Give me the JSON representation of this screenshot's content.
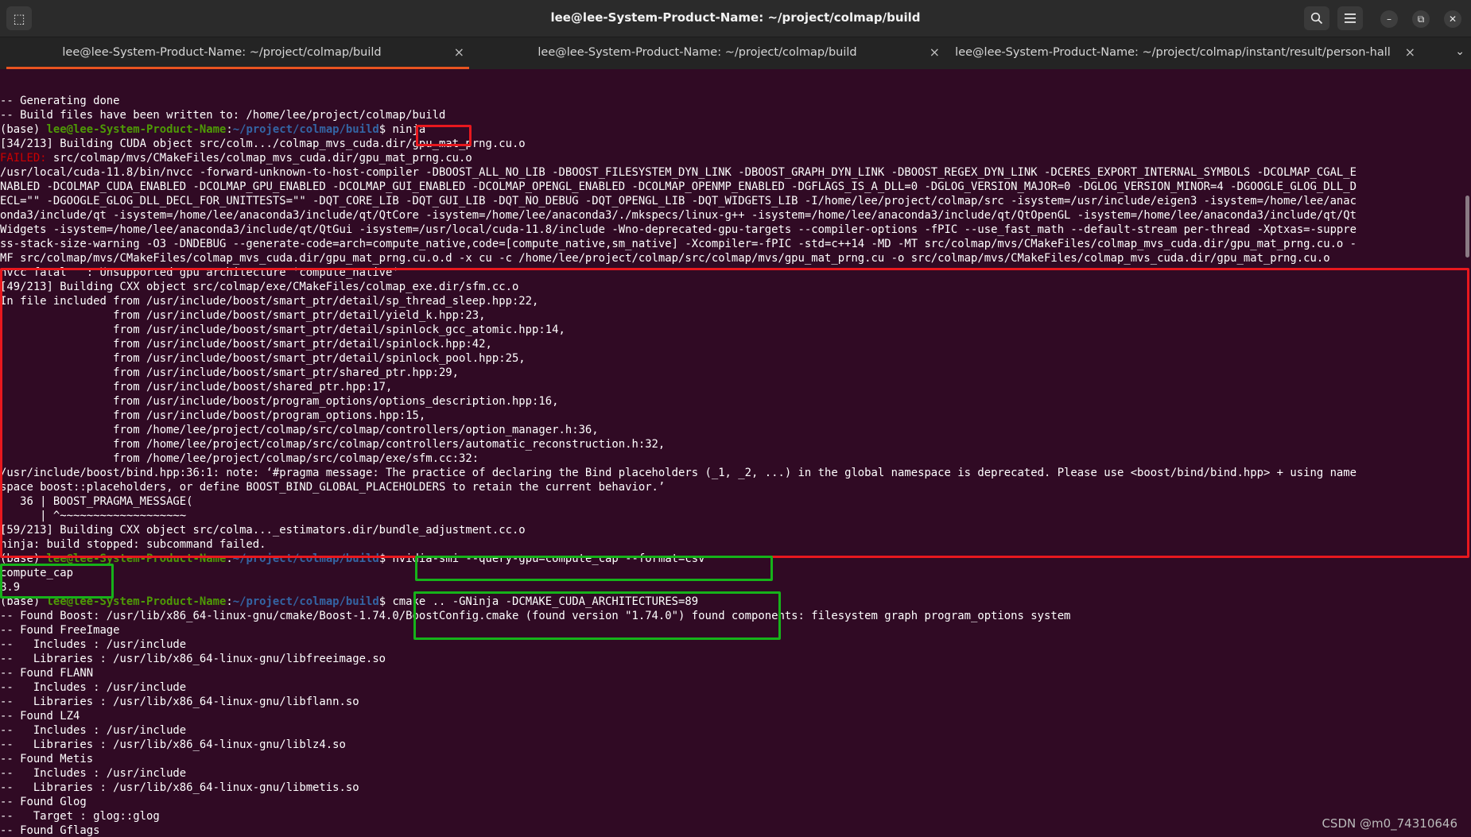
{
  "window": {
    "title": "lee@lee-System-Product-Name: ~/project/colmap/build",
    "new_tab_icon": "⬚",
    "search_icon": "⌕",
    "menu_icon": "☰",
    "minimize_icon": "–",
    "maximize_icon": "⧉",
    "close_icon": "✕"
  },
  "tabs": [
    {
      "label": "lee@lee-System-Product-Name: ~/project/colmap/build",
      "close": "×"
    },
    {
      "label": "lee@lee-System-Product-Name: ~/project/colmap/build",
      "close": "×"
    },
    {
      "label": "lee@lee-System-Product-Name: ~/project/colmap/instant/result/person-hall",
      "close": "×"
    }
  ],
  "tab_menu_icon": "⌄",
  "colors": {
    "background": "#300a24",
    "prompt_user": "#4e9a06",
    "prompt_path": "#3465a4",
    "failed": "#cc0000",
    "annotation_red": "#e8181e",
    "annotation_green": "#16b21a",
    "active_tab_underline": "#e95420"
  },
  "terminal": {
    "lines": [
      {
        "segments": [
          {
            "text": "-- Generating done",
            "style": ""
          }
        ]
      },
      {
        "segments": [
          {
            "text": "-- Build files have been written to: /home/lee/project/colmap/build",
            "style": ""
          }
        ]
      },
      {
        "segments": [
          {
            "text": "(base) ",
            "style": ""
          },
          {
            "text": "lee@lee-System-Product-Name",
            "style": "user"
          },
          {
            "text": ":",
            "style": ""
          },
          {
            "text": "~/project/colmap/build",
            "style": "path"
          },
          {
            "text": "$ ninja",
            "style": ""
          }
        ]
      },
      {
        "segments": [
          {
            "text": "[34/213] Building CUDA object src/colm.../colmap_mvs_cuda.dir/gpu_mat_prng.cu.o",
            "style": ""
          }
        ]
      },
      {
        "segments": [
          {
            "text": "FAILED:",
            "style": "failed"
          },
          {
            "text": " src/colmap/mvs/CMakeFiles/colmap_mvs_cuda.dir/gpu_mat_prng.cu.o",
            "style": ""
          }
        ]
      },
      {
        "segments": [
          {
            "text": "/usr/local/cuda-11.8/bin/nvcc -forward-unknown-to-host-compiler -DBOOST_ALL_NO_LIB -DBOOST_FILESYSTEM_DYN_LINK -DBOOST_GRAPH_DYN_LINK -DBOOST_REGEX_DYN_LINK -DCERES_EXPORT_INTERNAL_SYMBOLS -DCOLMAP_CGAL_E",
            "style": ""
          }
        ]
      },
      {
        "segments": [
          {
            "text": "NABLED -DCOLMAP_CUDA_ENABLED -DCOLMAP_GPU_ENABLED -DCOLMAP_GUI_ENABLED -DCOLMAP_OPENGL_ENABLED -DCOLMAP_OPENMP_ENABLED -DGFLAGS_IS_A_DLL=0 -DGLOG_VERSION_MAJOR=0 -DGLOG_VERSION_MINOR=4 -DGOOGLE_GLOG_DLL_D",
            "style": ""
          }
        ]
      },
      {
        "segments": [
          {
            "text": "ECL=\"\" -DGOOGLE_GLOG_DLL_DECL_FOR_UNITTESTS=\"\" -DQT_CORE_LIB -DQT_GUI_LIB -DQT_NO_DEBUG -DQT_OPENGL_LIB -DQT_WIDGETS_LIB -I/home/lee/project/colmap/src -isystem=/usr/include/eigen3 -isystem=/home/lee/anac",
            "style": ""
          }
        ]
      },
      {
        "segments": [
          {
            "text": "onda3/include/qt -isystem=/home/lee/anaconda3/include/qt/QtCore -isystem=/home/lee/anaconda3/./mkspecs/linux-g++ -isystem=/home/lee/anaconda3/include/qt/QtOpenGL -isystem=/home/lee/anaconda3/include/qt/Qt",
            "style": ""
          }
        ]
      },
      {
        "segments": [
          {
            "text": "Widgets -isystem=/home/lee/anaconda3/include/qt/QtGui -isystem=/usr/local/cuda-11.8/include -Wno-deprecated-gpu-targets --compiler-options -fPIC --use_fast_math --default-stream per-thread -Xptxas=-suppre",
            "style": ""
          }
        ]
      },
      {
        "segments": [
          {
            "text": "ss-stack-size-warning -O3 -DNDEBUG --generate-code=arch=compute_native,code=[compute_native,sm_native] -Xcompiler=-fPIC -std=c++14 -MD -MT src/colmap/mvs/CMakeFiles/colmap_mvs_cuda.dir/gpu_mat_prng.cu.o -",
            "style": ""
          }
        ]
      },
      {
        "segments": [
          {
            "text": "MF src/colmap/mvs/CMakeFiles/colmap_mvs_cuda.dir/gpu_mat_prng.cu.o.d -x cu -c /home/lee/project/colmap/src/colmap/mvs/gpu_mat_prng.cu -o src/colmap/mvs/CMakeFiles/colmap_mvs_cuda.dir/gpu_mat_prng.cu.o",
            "style": ""
          }
        ]
      },
      {
        "segments": [
          {
            "text": "nvcc fatal   : Unsupported gpu architecture 'compute_native'",
            "style": ""
          }
        ]
      },
      {
        "segments": [
          {
            "text": "[49/213] Building CXX object src/colmap/exe/CMakeFiles/colmap_exe.dir/sfm.cc.o",
            "style": ""
          }
        ]
      },
      {
        "segments": [
          {
            "text": "In file included from /usr/include/boost/smart_ptr/detail/sp_thread_sleep.hpp:22,",
            "style": ""
          }
        ]
      },
      {
        "segments": [
          {
            "text": "                 from /usr/include/boost/smart_ptr/detail/yield_k.hpp:23,",
            "style": ""
          }
        ]
      },
      {
        "segments": [
          {
            "text": "                 from /usr/include/boost/smart_ptr/detail/spinlock_gcc_atomic.hpp:14,",
            "style": ""
          }
        ]
      },
      {
        "segments": [
          {
            "text": "                 from /usr/include/boost/smart_ptr/detail/spinlock.hpp:42,",
            "style": ""
          }
        ]
      },
      {
        "segments": [
          {
            "text": "                 from /usr/include/boost/smart_ptr/detail/spinlock_pool.hpp:25,",
            "style": ""
          }
        ]
      },
      {
        "segments": [
          {
            "text": "                 from /usr/include/boost/smart_ptr/shared_ptr.hpp:29,",
            "style": ""
          }
        ]
      },
      {
        "segments": [
          {
            "text": "                 from /usr/include/boost/shared_ptr.hpp:17,",
            "style": ""
          }
        ]
      },
      {
        "segments": [
          {
            "text": "                 from /usr/include/boost/program_options/options_description.hpp:16,",
            "style": ""
          }
        ]
      },
      {
        "segments": [
          {
            "text": "                 from /usr/include/boost/program_options.hpp:15,",
            "style": ""
          }
        ]
      },
      {
        "segments": [
          {
            "text": "                 from /home/lee/project/colmap/src/colmap/controllers/option_manager.h:36,",
            "style": ""
          }
        ]
      },
      {
        "segments": [
          {
            "text": "                 from /home/lee/project/colmap/src/colmap/controllers/automatic_reconstruction.h:32,",
            "style": ""
          }
        ]
      },
      {
        "segments": [
          {
            "text": "                 from /home/lee/project/colmap/src/colmap/exe/sfm.cc:32:",
            "style": ""
          }
        ]
      },
      {
        "segments": [
          {
            "text": "/usr/include/boost/bind.hpp:36:1: note: ‘#pragma message: The practice of declaring the Bind placeholders (_1, _2, ...) in the global namespace is deprecated. Please use <boost/bind/bind.hpp> + using name",
            "style": ""
          }
        ]
      },
      {
        "segments": [
          {
            "text": "space boost::placeholders, or define BOOST_BIND_GLOBAL_PLACEHOLDERS to retain the current behavior.’",
            "style": ""
          }
        ]
      },
      {
        "segments": [
          {
            "text": "   36 | BOOST_PRAGMA_MESSAGE(",
            "style": ""
          }
        ]
      },
      {
        "segments": [
          {
            "text": "      | ^~~~~~~~~~~~~~~~~~~~",
            "style": ""
          }
        ]
      },
      {
        "segments": [
          {
            "text": "[59/213] Building CXX object src/colma..._estimators.dir/bundle_adjustment.cc.o",
            "style": ""
          }
        ]
      },
      {
        "segments": [
          {
            "text": "ninja: build stopped: subcommand failed.",
            "style": ""
          }
        ]
      },
      {
        "segments": [
          {
            "text": "(base) ",
            "style": ""
          },
          {
            "text": "lee@lee-System-Product-Name",
            "style": "user"
          },
          {
            "text": ":",
            "style": ""
          },
          {
            "text": "~/project/colmap/build",
            "style": "path"
          },
          {
            "text": "$ nvidia-smi --query-gpu=compute_cap --format=csv",
            "style": ""
          }
        ]
      },
      {
        "segments": [
          {
            "text": "compute_cap",
            "style": ""
          }
        ]
      },
      {
        "segments": [
          {
            "text": "8.9",
            "style": ""
          }
        ]
      },
      {
        "segments": [
          {
            "text": "(base) ",
            "style": ""
          },
          {
            "text": "lee@lee-System-Product-Name",
            "style": "user"
          },
          {
            "text": ":",
            "style": ""
          },
          {
            "text": "~/project/colmap/build",
            "style": "path"
          },
          {
            "text": "$ cmake .. -GNinja -DCMAKE_CUDA_ARCHITECTURES=89",
            "style": ""
          }
        ]
      },
      {
        "segments": [
          {
            "text": "-- Found Boost: /usr/lib/x86_64-linux-gnu/cmake/Boost-1.74.0/BoostConfig.cmake (found version \"1.74.0\") found components: filesystem graph program_options system",
            "style": ""
          }
        ]
      },
      {
        "segments": [
          {
            "text": "-- Found FreeImage",
            "style": ""
          }
        ]
      },
      {
        "segments": [
          {
            "text": "--   Includes : /usr/include",
            "style": ""
          }
        ]
      },
      {
        "segments": [
          {
            "text": "--   Libraries : /usr/lib/x86_64-linux-gnu/libfreeimage.so",
            "style": ""
          }
        ]
      },
      {
        "segments": [
          {
            "text": "-- Found FLANN",
            "style": ""
          }
        ]
      },
      {
        "segments": [
          {
            "text": "--   Includes : /usr/include",
            "style": ""
          }
        ]
      },
      {
        "segments": [
          {
            "text": "--   Libraries : /usr/lib/x86_64-linux-gnu/libflann.so",
            "style": ""
          }
        ]
      },
      {
        "segments": [
          {
            "text": "-- Found LZ4",
            "style": ""
          }
        ]
      },
      {
        "segments": [
          {
            "text": "--   Includes : /usr/include",
            "style": ""
          }
        ]
      },
      {
        "segments": [
          {
            "text": "--   Libraries : /usr/lib/x86_64-linux-gnu/liblz4.so",
            "style": ""
          }
        ]
      },
      {
        "segments": [
          {
            "text": "-- Found Metis",
            "style": ""
          }
        ]
      },
      {
        "segments": [
          {
            "text": "--   Includes : /usr/include",
            "style": ""
          }
        ]
      },
      {
        "segments": [
          {
            "text": "--   Libraries : /usr/lib/x86_64-linux-gnu/libmetis.so",
            "style": ""
          }
        ]
      },
      {
        "segments": [
          {
            "text": "-- Found Glog",
            "style": ""
          }
        ]
      },
      {
        "segments": [
          {
            "text": "--   Target : glog::glog",
            "style": ""
          }
        ]
      },
      {
        "segments": [
          {
            "text": "-- Found Gflags",
            "style": ""
          }
        ]
      }
    ]
  },
  "watermark": "CSDN @m0_74310646"
}
